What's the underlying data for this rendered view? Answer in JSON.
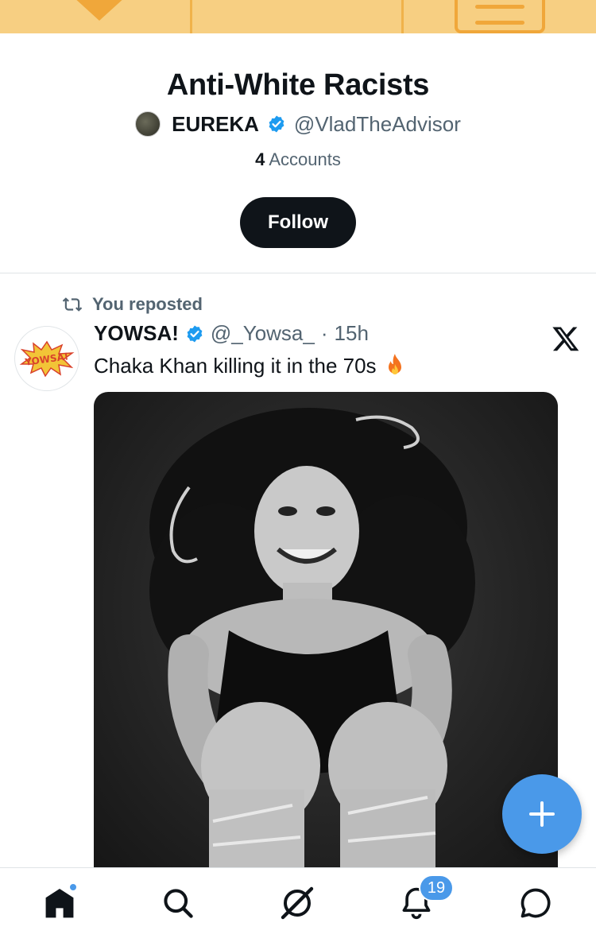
{
  "list": {
    "title": "Anti-White Racists",
    "owner_name": "EUREKA",
    "owner_handle": "@VladTheAdvisor",
    "member_count": "4",
    "member_count_label": "Accounts",
    "follow_label": "Follow"
  },
  "tweet": {
    "repost_label": "You reposted",
    "author_name": "YOWSA!",
    "author_handle": "@_Yowsa_",
    "separator": "·",
    "time": "15h",
    "text": "Chaka Khan killing it in the 70s",
    "avatar_text": "YOWSA!"
  },
  "nav": {
    "notifications_badge": "19"
  },
  "colors": {
    "accent": "#4a99e9",
    "banner": "#f7cf82",
    "text_primary": "#0f1419",
    "text_secondary": "#536471"
  }
}
